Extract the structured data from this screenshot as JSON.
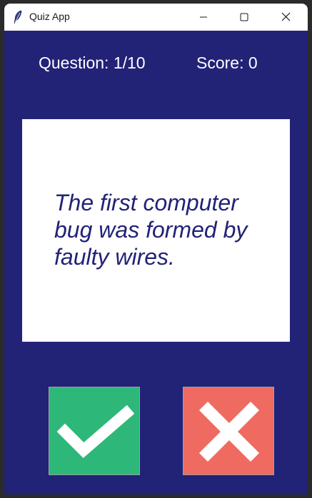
{
  "window": {
    "title": "Quiz App",
    "icon": "feather-icon",
    "controls": [
      "minimize-icon",
      "maximize-icon",
      "close-icon"
    ]
  },
  "stats": {
    "question_label": "Question: 1/10",
    "score_label": "Score: 0"
  },
  "card": {
    "question": "The first computer bug was formed by faulty wires."
  },
  "buttons": {
    "true_icon": "checkmark-icon",
    "false_icon": "cross-icon"
  },
  "colors": {
    "background": "#222277",
    "card": "#ffffff",
    "question_text": "#222277",
    "true_button": "#2db879",
    "false_button": "#ef6b61"
  }
}
